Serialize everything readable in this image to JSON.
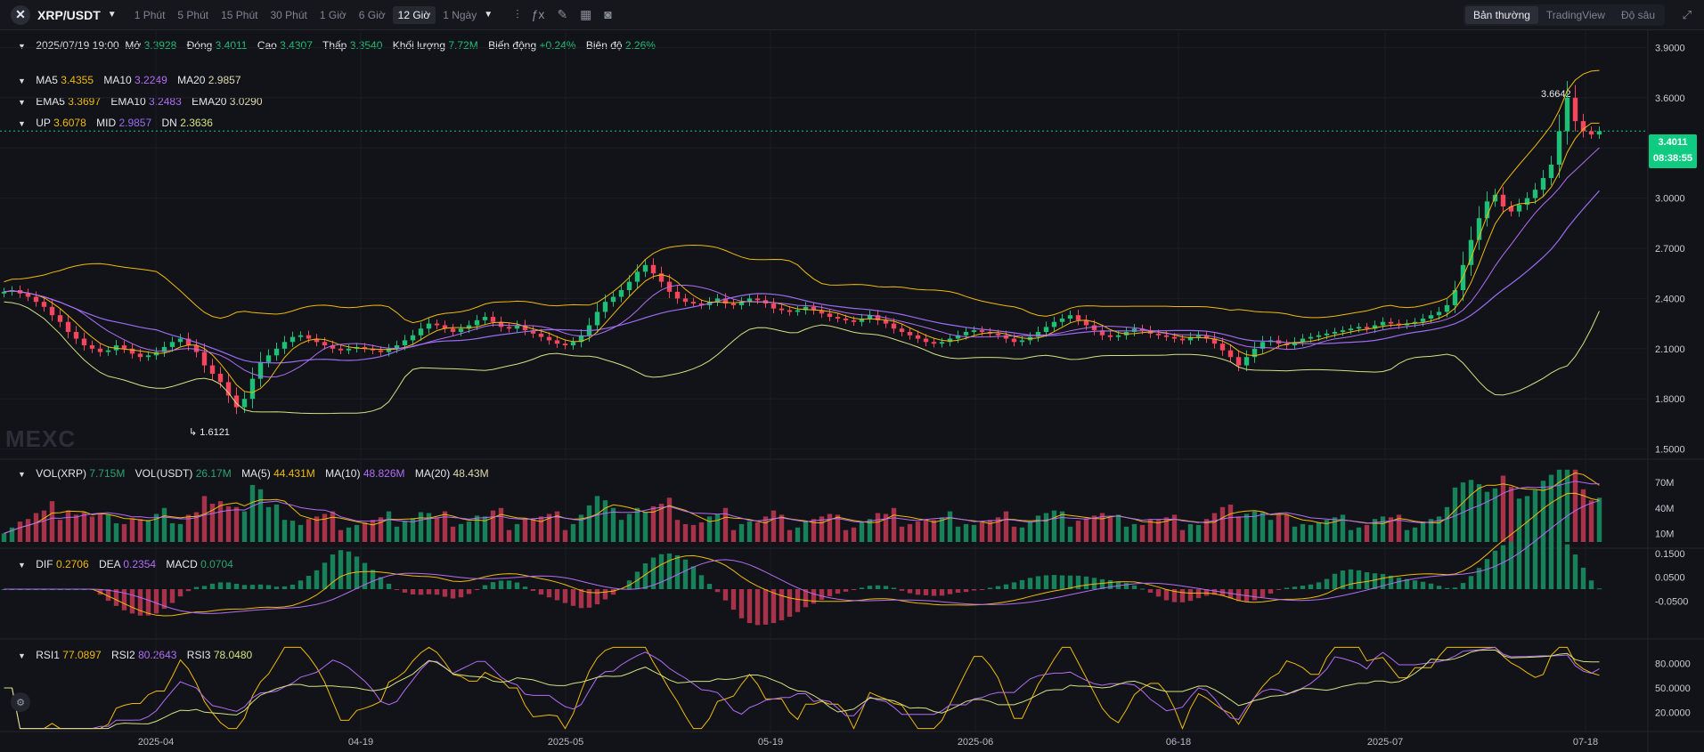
{
  "header": {
    "pair": "XRP/USDT",
    "intervals": [
      "1 Phút",
      "5 Phút",
      "15 Phút",
      "30 Phút",
      "1 Giờ",
      "6 Giờ",
      "12 Giờ",
      "1 Ngày"
    ],
    "active_interval": "12 Giờ",
    "views": [
      "Bản thường",
      "TradingView",
      "Độ sâu"
    ],
    "active_view": "Bản thường"
  },
  "ohlc": {
    "date": "2025/07/19 19:00",
    "open_label": "Mở",
    "open": "3.3928",
    "close_label": "Đóng",
    "close": "3.4011",
    "high_label": "Cao",
    "high": "3.4307",
    "low_label": "Thấp",
    "low": "3.3540",
    "volume_label": "Khối lượng",
    "volume": "7.72M",
    "change_label": "Biến động",
    "change": "+0.24%",
    "amplitude_label": "Biên độ",
    "amplitude": "2.26%"
  },
  "ma": {
    "ma5_label": "MA5",
    "ma5": "3.4355",
    "ma10_label": "MA10",
    "ma10": "3.2249",
    "ma20_label": "MA20",
    "ma20": "2.9857"
  },
  "ema": {
    "ema5_label": "EMA5",
    "ema5": "3.3697",
    "ema10_label": "EMA10",
    "ema10": "3.2483",
    "ema20_label": "EMA20",
    "ema20": "3.0290"
  },
  "boll": {
    "up_label": "UP",
    "up": "3.6078",
    "mid_label": "MID",
    "mid": "2.9857",
    "dn_label": "DN",
    "dn": "2.3636"
  },
  "vol": {
    "vol_xrp_label": "VOL(XRP)",
    "vol_xrp": "7.715M",
    "vol_usdt_label": "VOL(USDT)",
    "vol_usdt": "26.17M",
    "ma5_label": "MA(5)",
    "ma5": "44.431M",
    "ma10_label": "MA(10)",
    "ma10": "48.826M",
    "ma20_label": "MA(20)",
    "ma20": "48.43M",
    "axis": [
      "70M",
      "40M",
      "10M"
    ]
  },
  "macd": {
    "dif_label": "DIF",
    "dif": "0.2706",
    "dea_label": "DEA",
    "dea": "0.2354",
    "macd_label": "MACD",
    "macd": "0.0704",
    "axis": [
      "0.1500",
      "0.0500",
      "-0.0500"
    ]
  },
  "rsi": {
    "rsi1_label": "RSI1",
    "rsi1": "77.0897",
    "rsi2_label": "RSI2",
    "rsi2": "80.2643",
    "rsi3_label": "RSI3",
    "rsi3": "78.0480",
    "axis": [
      "80.0000",
      "50.0000",
      "20.0000"
    ]
  },
  "price_axis": [
    "3.9000",
    "3.6000",
    "3.3000",
    "3.0000",
    "2.7000",
    "2.4000",
    "2.1000",
    "1.8000",
    "1.5000"
  ],
  "last_price": "3.4011",
  "countdown": "08:38:55",
  "high_marker": "3.6642",
  "low_marker": "1.6121",
  "watermark": "MEXC",
  "x_labels": [
    "2025-04",
    "04-19",
    "2025-05",
    "05-19",
    "2025-06",
    "06-18",
    "2025-07",
    "07-18"
  ],
  "colors": {
    "up": "#1fbf75",
    "down": "#f6465d",
    "ma5": "#f0b90b",
    "ma10": "#b26df4",
    "ma20": "#ded9b0",
    "boll_up": "#f0b90b",
    "boll_mid": "#9a6cf0",
    "boll_dn": "#d7e081"
  },
  "chart_data": {
    "type": "candlestick",
    "series_closes": [
      2.44,
      2.45,
      2.43,
      2.41,
      2.38,
      2.35,
      2.3,
      2.26,
      2.2,
      2.16,
      2.12,
      2.1,
      2.08,
      2.09,
      2.12,
      2.1,
      2.07,
      2.05,
      2.06,
      2.08,
      2.11,
      2.14,
      2.16,
      2.12,
      2.08,
      2.0,
      1.95,
      1.9,
      1.82,
      1.75,
      1.8,
      1.92,
      2.02,
      2.06,
      2.1,
      2.14,
      2.17,
      2.18,
      2.16,
      2.14,
      2.12,
      2.1,
      2.09,
      2.1,
      2.11,
      2.1,
      2.09,
      2.08,
      2.1,
      2.12,
      2.15,
      2.18,
      2.22,
      2.25,
      2.24,
      2.22,
      2.2,
      2.22,
      2.24,
      2.27,
      2.29,
      2.26,
      2.23,
      2.22,
      2.24,
      2.21,
      2.19,
      2.17,
      2.15,
      2.13,
      2.12,
      2.14,
      2.18,
      2.24,
      2.32,
      2.38,
      2.41,
      2.45,
      2.5,
      2.56,
      2.6,
      2.55,
      2.5,
      2.44,
      2.4,
      2.38,
      2.37,
      2.36,
      2.38,
      2.4,
      2.37,
      2.36,
      2.38,
      2.4,
      2.39,
      2.37,
      2.34,
      2.33,
      2.32,
      2.33,
      2.35,
      2.33,
      2.31,
      2.29,
      2.28,
      2.27,
      2.26,
      2.28,
      2.3,
      2.27,
      2.25,
      2.22,
      2.2,
      2.18,
      2.16,
      2.14,
      2.13,
      2.14,
      2.16,
      2.18,
      2.2,
      2.21,
      2.2,
      2.19,
      2.18,
      2.16,
      2.14,
      2.15,
      2.17,
      2.2,
      2.23,
      2.26,
      2.28,
      2.3,
      2.27,
      2.24,
      2.21,
      2.18,
      2.17,
      2.18,
      2.2,
      2.22,
      2.21,
      2.19,
      2.18,
      2.17,
      2.16,
      2.15,
      2.17,
      2.18,
      2.16,
      2.13,
      2.09,
      2.05,
      2.0,
      2.05,
      2.1,
      2.14,
      2.15,
      2.13,
      2.12,
      2.14,
      2.16,
      2.17,
      2.18,
      2.19,
      2.2,
      2.21,
      2.22,
      2.23,
      2.22,
      2.24,
      2.26,
      2.25,
      2.24,
      2.25,
      2.26,
      2.28,
      2.3,
      2.32,
      2.36,
      2.45,
      2.6,
      2.75,
      2.88,
      2.98,
      3.02,
      2.95,
      2.92,
      2.96,
      3.0,
      3.05,
      3.12,
      3.2,
      3.4,
      3.6,
      3.46,
      3.4,
      3.38,
      3.4
    ],
    "high": 3.6642,
    "low": 1.6121,
    "ylim": [
      1.45,
      3.95
    ]
  }
}
